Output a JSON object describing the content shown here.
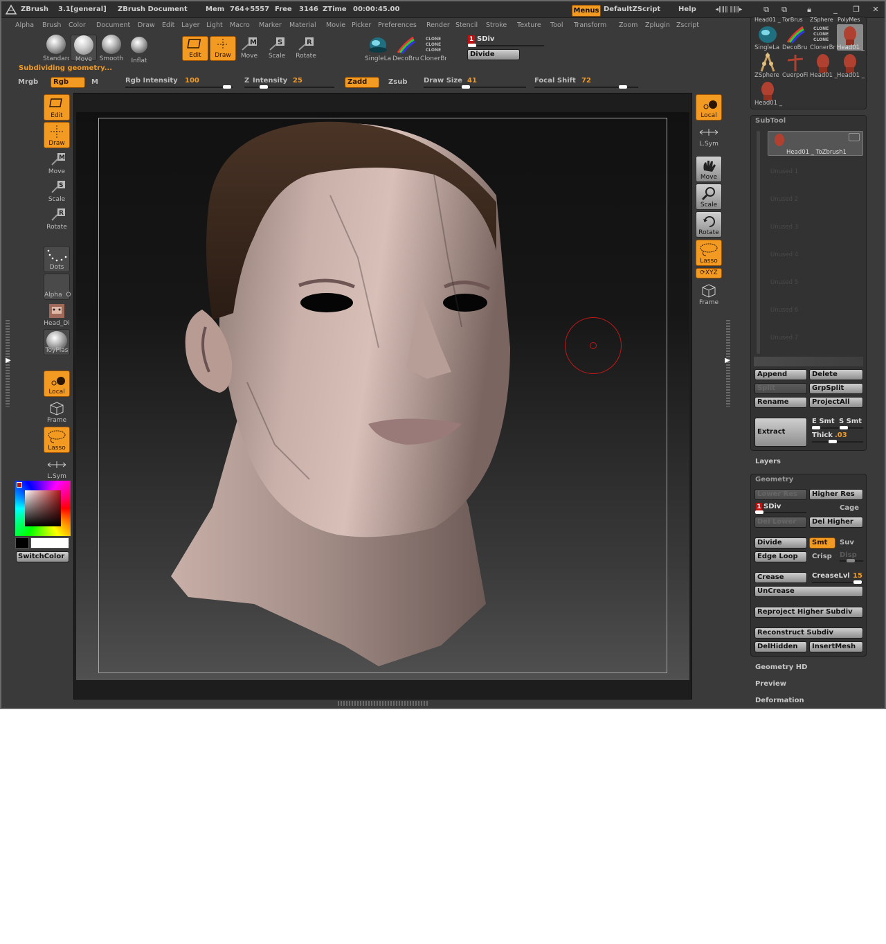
{
  "title_bar": {
    "app": "ZBrush",
    "version": "3.1[general]",
    "document": "ZBrush Document",
    "mem_label": "Mem",
    "mem_value": "764+5557",
    "free_label": "Free",
    "free_value": "3146",
    "ztime_label": "ZTime",
    "ztime_value": "00:00:45.00",
    "menus_button": "Menus",
    "script": "DefaultZScript",
    "help": "Help"
  },
  "menu_bar": [
    "Alpha",
    "Brush",
    "Color",
    "Document",
    "Draw",
    "Edit",
    "Layer",
    "Light",
    "Macro",
    "Marker",
    "Material",
    "Movie",
    "Picker",
    "Preferences",
    "Render",
    "Stencil",
    "Stroke",
    "Texture",
    "Tool",
    "Transform",
    "Zoom",
    "Zplugin",
    "Zscript"
  ],
  "brush_shelf": [
    "Standard",
    "Move",
    "Smooth",
    "Inflat"
  ],
  "transform_tools": [
    "Edit",
    "Draw",
    "Move",
    "Scale",
    "Rotate"
  ],
  "tool_shelf": [
    "SingleLa",
    "DecoBru",
    "ClonerBr"
  ],
  "clone_text": "CLONE",
  "sdiv": {
    "value": "1",
    "label": "SDiv"
  },
  "divide_button": "Divide",
  "status_message": "Subdividing geometry...",
  "draw_bar": {
    "mrgb": "Mrgb",
    "rgb": "Rgb",
    "m": "M",
    "rgb_intensity_label": "Rgb Intensity",
    "rgb_intensity_value": "100",
    "z_label": "Z",
    "z_intensity_label": "Intensity",
    "z_intensity_value": "25",
    "zadd": "Zadd",
    "zsub": "Zsub",
    "draw_size_label": "Draw Size",
    "draw_size_value": "41",
    "focal_shift_label": "Focal Shift",
    "focal_shift_value": "72"
  },
  "left_shelf": {
    "edit": "Edit",
    "draw": "Draw",
    "move": "Move",
    "scale": "Scale",
    "rotate": "Rotate",
    "dots": "Dots",
    "alpha": "Alpha",
    "alpha_o": "O",
    "head_di": "Head_Di",
    "toyplas": "ToyPlas",
    "local": "Local",
    "frame": "Frame",
    "lasso": "Lasso",
    "lsym": "L.Sym",
    "switch_color": "SwitchColor"
  },
  "right_shelf": [
    "Local",
    "L.Sym",
    "Move",
    "Scale",
    "Rotate",
    "Lasso",
    "XYZ",
    "Frame"
  ],
  "tool_palette": {
    "top_labels": [
      "Head01 _",
      "TorBrus",
      "ZSphere",
      "PolyMes"
    ],
    "row1": [
      "SingleLa",
      "DecoBru",
      "ClonerBr",
      "Head01 _"
    ],
    "row2": [
      "ZSphere",
      "CuerpoFi",
      "Head01 _",
      "Head01 _"
    ],
    "row3": [
      "Head01 _"
    ]
  },
  "subtool": {
    "header": "SubTool",
    "active": "Head01 _ ToZbrush1",
    "unused": [
      "Unused 1",
      "Unused 2",
      "Unused 3",
      "Unused 4",
      "Unused 5",
      "Unused 6",
      "Unused 7"
    ],
    "append": "Append",
    "delete": "Delete",
    "split": "Split",
    "grpsplit": "GrpSplit",
    "rename": "Rename",
    "projectall": "ProjectAll",
    "extract": "Extract",
    "e_smt": "E Smt",
    "s_smt": "S Smt",
    "thick_label": "Thick",
    "thick_value": ".03"
  },
  "layers_header": "Layers",
  "geometry": {
    "header": "Geometry",
    "lower_res": "Lower Res",
    "higher_res": "Higher Res",
    "sdiv_value": "1",
    "sdiv_label": "SDiv",
    "cage": "Cage",
    "del_lower": "Del Lower",
    "del_higher": "Del Higher",
    "divide": "Divide",
    "smt": "Smt",
    "suv": "Suv",
    "edge_loop": "Edge Loop",
    "crisp": "Crisp",
    "disp": "Disp",
    "crease": "Crease",
    "creaselvl_label": "CreaseLvl",
    "creaselvl_value": "15",
    "uncrease": "UnCrease",
    "reproject": "Reproject Higher Subdiv",
    "reconstruct": "Reconstruct Subdiv",
    "delhidden": "DelHidden",
    "insertmesh": "InsertMesh"
  },
  "bottom_sections": [
    "Geometry HD",
    "Preview",
    "Deformation"
  ],
  "accent_color": "#f39a22"
}
